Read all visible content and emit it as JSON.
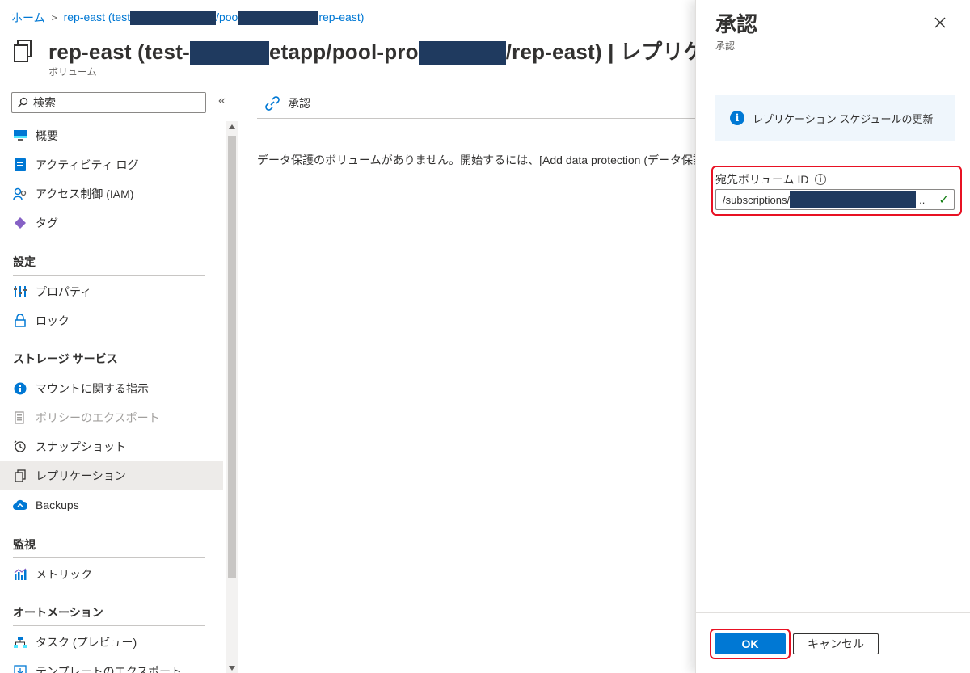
{
  "breadcrumb": {
    "home": "ホーム",
    "item_prefix": "rep-east (test",
    "item_middle": "/poo",
    "item_suffix": "rep-east)"
  },
  "header": {
    "title_part1": "rep-east (test-",
    "title_part2": "etapp/pool-pro",
    "title_part3": "/rep-east) | レプリケー",
    "subtitle": "ボリューム"
  },
  "search": {
    "placeholder": "検索"
  },
  "sidebar": {
    "collapse_glyph": "«",
    "items": [
      {
        "label": "概要",
        "icon": "overview-icon"
      },
      {
        "label": "アクティビティ ログ",
        "icon": "activity-log-icon"
      },
      {
        "label": "アクセス制御 (IAM)",
        "icon": "iam-icon"
      },
      {
        "label": "タグ",
        "icon": "tag-icon"
      }
    ],
    "sections": [
      {
        "header": "設定",
        "items": [
          {
            "label": "プロパティ",
            "icon": "properties-icon"
          },
          {
            "label": "ロック",
            "icon": "lock-icon"
          }
        ]
      },
      {
        "header": "ストレージ サービス",
        "items": [
          {
            "label": "マウントに関する指示",
            "icon": "info-icon"
          },
          {
            "label": "ポリシーのエクスポート",
            "icon": "export-policy-icon"
          },
          {
            "label": "スナップショット",
            "icon": "snapshot-icon"
          },
          {
            "label": "レプリケーション",
            "icon": "replication-icon"
          },
          {
            "label": "Backups",
            "icon": "backups-icon"
          }
        ]
      },
      {
        "header": "監視",
        "items": [
          {
            "label": "メトリック",
            "icon": "metrics-icon"
          }
        ]
      },
      {
        "header": "オートメーション",
        "items": [
          {
            "label": "タスク (プレビュー)",
            "icon": "tasks-icon"
          },
          {
            "label": "テンプレートのエクスポート",
            "icon": "template-export-icon"
          }
        ]
      }
    ],
    "selected": "レプリケーション"
  },
  "main": {
    "command_label": "承認",
    "message": "データ保護のボリュームがありません。開始するには、[Add data protection (データ保護の追加"
  },
  "panel": {
    "title": "承認",
    "subtitle": "承認",
    "info_text": "レプリケーション スケジュールの更新",
    "field_label": "宛先ボリューム ID",
    "field_value_prefix": "/subscriptions/",
    "field_value_suffix": "..",
    "ok_label": "OK",
    "cancel_label": "キャンセル"
  },
  "colors": {
    "accent": "#0078d4",
    "highlight": "#e81123",
    "redaction": "#1f3a5f",
    "selected_bg": "#edebe9"
  }
}
